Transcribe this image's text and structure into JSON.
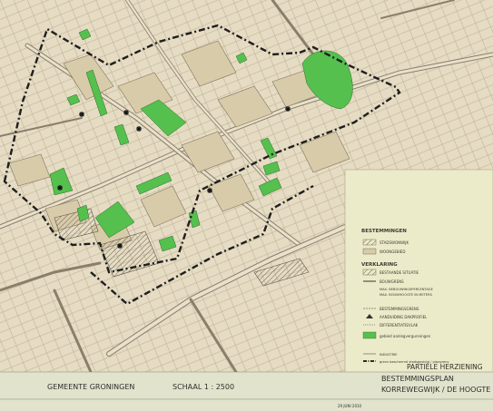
{
  "map": {
    "municipality": "GEMEENTE GRONINGEN",
    "scale": "SCHAAL 1 : 2500",
    "plan_title_1": "PARTIËLE HERZIENING",
    "plan_title_2": "BESTEMMINGSPLAN",
    "plan_title_3": "KORREWEGWIJK / DE HOOGTE",
    "footer_date": "29 JUNI 2010"
  },
  "legend": {
    "bestemmingen_heading": "BESTEMMINGEN",
    "stadswonwijk": "STADSWONWIJK",
    "wonen": "WOONGEBIED",
    "verklaring_heading": "VERKLARING",
    "bestaande_situatie": "BESTAANDE SITUATIE",
    "bouwgrens": "BOUWGRENS",
    "max_bebouwingspercentage": "MAX. BEBOUWINGSPERCENTAGE",
    "max_bouwhoogte": "MAX. BOUWHOOGTE IN METERS",
    "bestemmingsgrens": "BESTEMMINGSGRENS",
    "aanduiding_dakprofiel": "AANDUIDING DAKPROFIEL",
    "differentiatievlak": "DIFFERENTIATIEVLAK",
    "groen": "gebied aanlegvergunningen",
    "industrie": "INDUSTRIE",
    "planbeschermd": "grens beschermd stadsgezicht / plangrens"
  },
  "colors": {
    "paper": "#e6dcc4",
    "legend_panel": "#ecebc9",
    "green": "#55c04e",
    "street": "#8a7f6a",
    "boundary": "#1e1e1e"
  }
}
